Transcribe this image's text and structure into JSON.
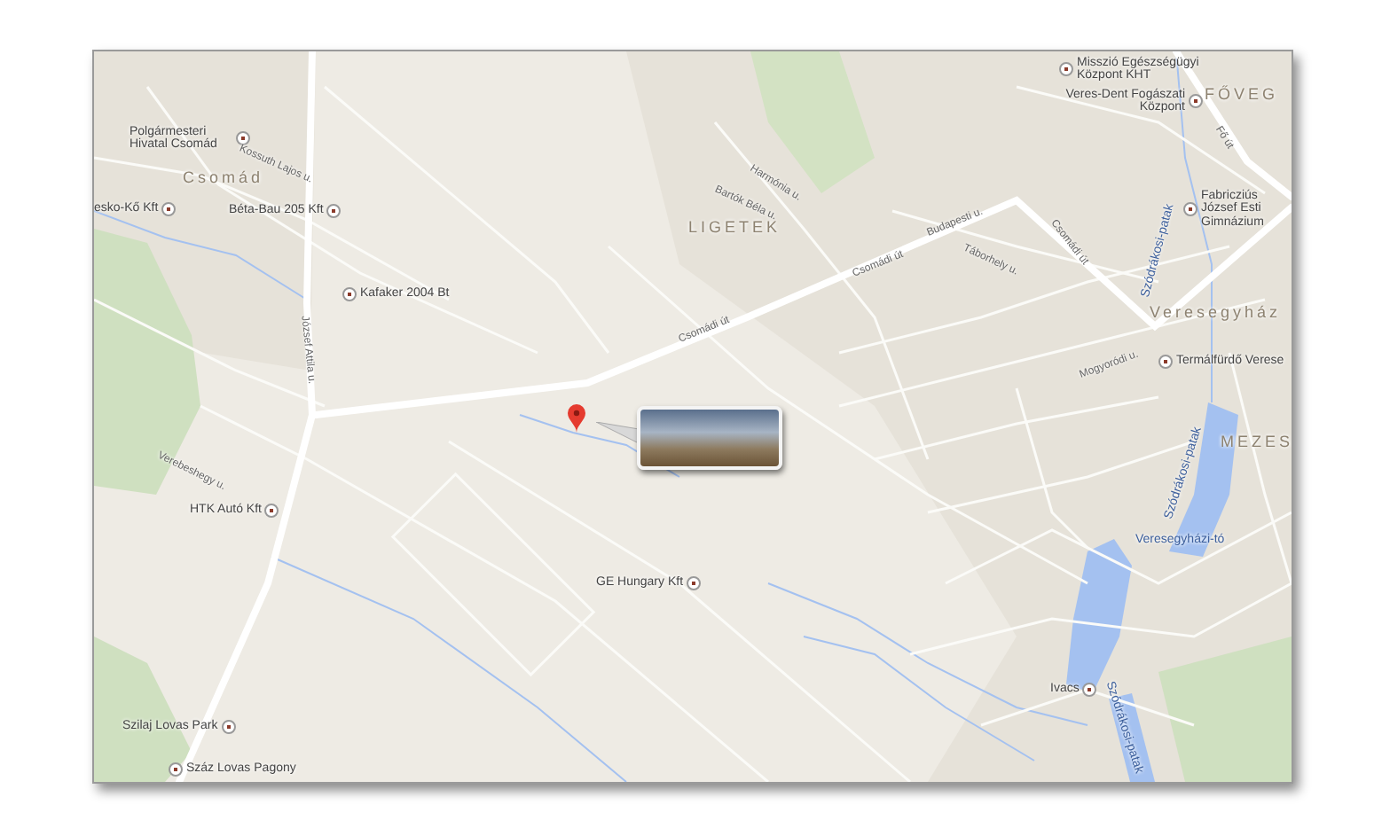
{
  "map": {
    "labels": [
      {
        "kind": "poi",
        "text": "Polgármesteri Hivatal Csomád"
      },
      {
        "kind": "place",
        "text": "Csomád"
      },
      {
        "kind": "poi",
        "text": "esko-Kő Kft"
      },
      {
        "kind": "poi",
        "text": "Béta-Bau 205 Kft"
      },
      {
        "kind": "poi",
        "text": "Kafaker 2004 Bt"
      },
      {
        "kind": "street",
        "text": "József Attila u."
      },
      {
        "kind": "street",
        "text": "Kossuth Lajos u."
      },
      {
        "kind": "street",
        "text": "Verebeshegy u."
      },
      {
        "kind": "poi",
        "text": "HTK Autó Kft"
      },
      {
        "kind": "poi",
        "text": "GE Hungary Kft"
      },
      {
        "kind": "poi",
        "text": "Szilaj Lovas Park"
      },
      {
        "kind": "poi",
        "text": "Száz Lovas Pagony"
      },
      {
        "kind": "place",
        "text": "LIGETEK"
      },
      {
        "kind": "street",
        "text": "Csomádi út"
      },
      {
        "kind": "street",
        "text": "Csomádi út"
      },
      {
        "kind": "street",
        "text": "Harmónia u."
      },
      {
        "kind": "street",
        "text": "Bartók Béla u."
      },
      {
        "kind": "street",
        "text": "Budapesti u."
      },
      {
        "kind": "street",
        "text": "Csomádi út"
      },
      {
        "kind": "poi",
        "text": "Misszió Egészségügyi Központ KHT"
      },
      {
        "kind": "poi",
        "text": "Veres-Dent Fogászati Központ"
      },
      {
        "kind": "place",
        "text": "FŐVEG"
      },
      {
        "kind": "street",
        "text": "Fő út"
      },
      {
        "kind": "poi",
        "text": "Fabricziús József Esti Gimnázium"
      },
      {
        "kind": "place",
        "text": "Veresegyház"
      },
      {
        "kind": "poi",
        "text": "Termálfürdő Verese"
      },
      {
        "kind": "water",
        "text": "Szódrákosi-patak"
      },
      {
        "kind": "place",
        "text": "MEZES"
      },
      {
        "kind": "water",
        "text": "Szódrákosi-patak"
      },
      {
        "kind": "water",
        "text": "Veresegyházi-tó"
      },
      {
        "kind": "water",
        "text": "Szódrákosi-patak"
      },
      {
        "kind": "poi",
        "text": "Ivacs"
      },
      {
        "kind": "street",
        "text": "Táborhely u."
      },
      {
        "kind": "street",
        "text": "Mogyoródi u."
      }
    ]
  }
}
